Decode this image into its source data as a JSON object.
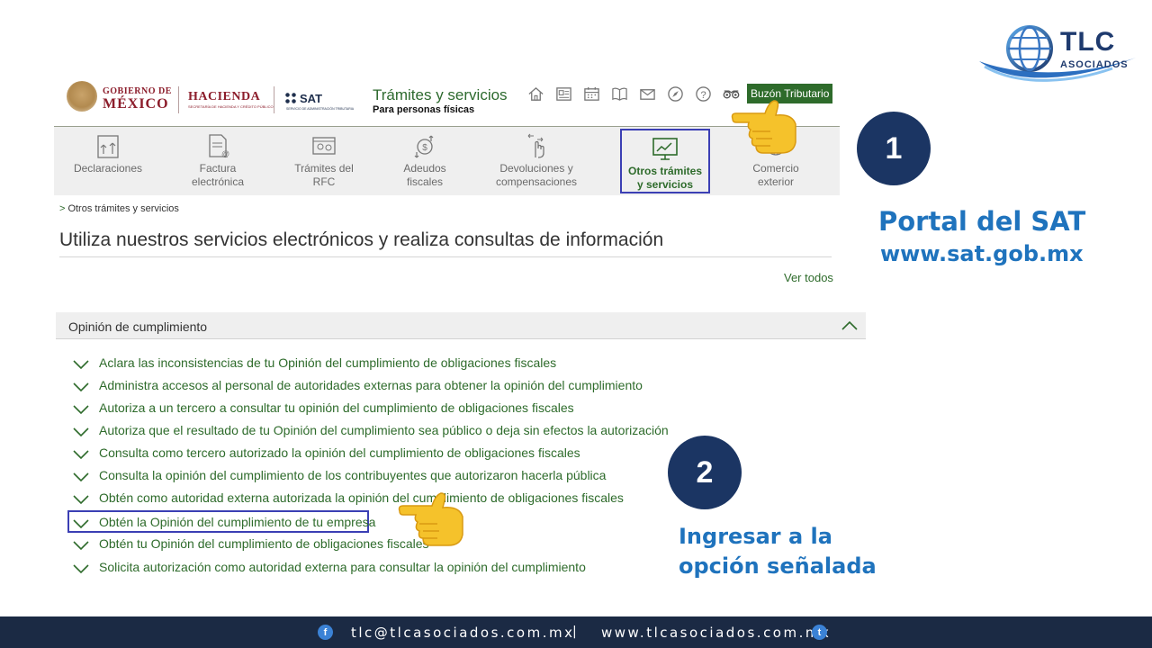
{
  "brand": {
    "name": "TLC",
    "sub": "ASOCIADOS"
  },
  "header": {
    "gob_line1": "GOBIERNO DE",
    "gob_line2": "MÉXICO",
    "hacienda": "HACIENDA",
    "hacienda_sub": "SECRETARÍA DE HACIENDA Y CRÉDITO PÚBLICO",
    "sat": "SAT",
    "sat_sub": "SERVICIO DE ADMINISTRACIÓN TRIBUTARIA",
    "site_title": "Trámites y servicios",
    "site_subtitle": "Para personas físicas",
    "icons": [
      "home-icon",
      "news-icon",
      "calendar-icon",
      "book-icon",
      "mail-icon",
      "compass-icon",
      "help-icon",
      "accessibility-icon"
    ],
    "buzon": "Buzón Tributario"
  },
  "nav": {
    "items": [
      {
        "label": "Declaraciones",
        "icon": "declarations-icon"
      },
      {
        "label": "Factura\nelectrónica",
        "icon": "invoice-icon"
      },
      {
        "label": "Trámites del\nRFC",
        "icon": "rfc-icon"
      },
      {
        "label": "Adeudos\nfiscales",
        "icon": "debts-icon"
      },
      {
        "label": "Devoluciones y\ncompensaciones",
        "icon": "refunds-icon"
      },
      {
        "label": "Otros trámites\ny servicios",
        "icon": "other-services-icon",
        "active": true
      },
      {
        "label": "Comercio\nexterior",
        "icon": "trade-icon"
      }
    ]
  },
  "breadcrumb": {
    "sep": ">",
    "text": "Otros trámites y servicios"
  },
  "page_title": "Utiliza nuestros servicios electrónicos y realiza consultas de información",
  "ver_todos": "Ver todos",
  "section": {
    "title": "Opinión de cumplimiento",
    "options": [
      "Aclara las inconsistencias de tu Opinión del cumplimiento de obligaciones fiscales",
      "Administra accesos al personal de autoridades externas para obtener la opinión del cumplimiento",
      "Autoriza a un tercero a consultar tu opinión del cumplimiento de obligaciones fiscales",
      "Autoriza que el resultado de tu Opinión del cumplimiento sea público o deja sin efectos la autorización",
      "Consulta como tercero autorizado la opinión del cumplimiento de obligaciones fiscales",
      "Consulta la opinión del cumplimiento de los contribuyentes que autorizaron hacerla pública",
      "Obtén como autoridad externa autorizada la opinión del cumplimiento de obligaciones fiscales",
      "Obtén la Opinión del cumplimiento de tu empresa",
      "Obtén tu Opinión del cumplimiento de obligaciones fiscales",
      "Solicita autorización como autoridad externa para consultar la opinión del cumplimiento"
    ],
    "highlighted_index": 7
  },
  "callouts": {
    "step1": "1",
    "step1_line1": "Portal del SAT",
    "step1_line2": "www.sat.gob.mx",
    "step2": "2",
    "step2_line1": "Ingresar a la",
    "step2_line2": "opción señalada"
  },
  "footer": {
    "email": "tlc@tlcasociados.com.mx",
    "sep": "|",
    "web": "www.tlcasociados.com.mx",
    "facebook_icon": "f",
    "twitter_icon": "t"
  },
  "colors": {
    "sat_green": "#2e6b2b",
    "highlight": "#3b3fb4",
    "navy": "#1b3563",
    "caption_blue": "#1f73bd",
    "footer": "#1b2a44"
  }
}
